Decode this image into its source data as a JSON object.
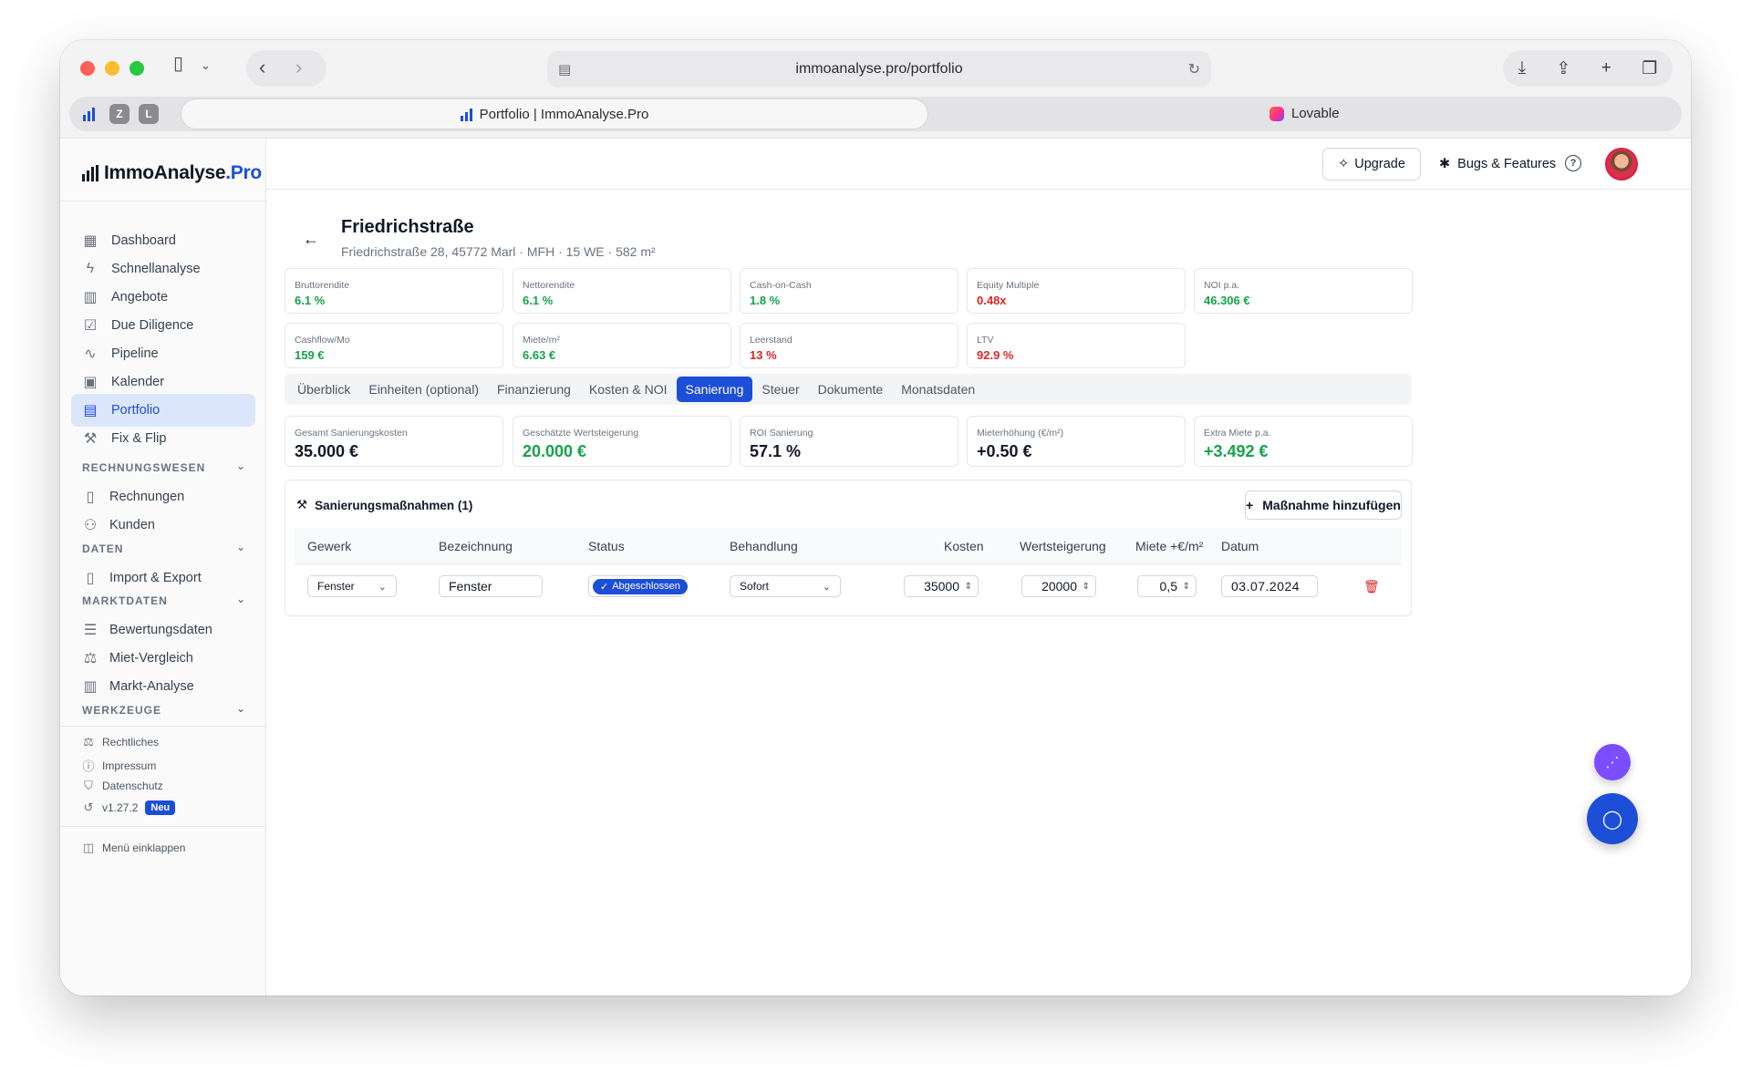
{
  "browser": {
    "url": "immoanalyse.pro/portfolio",
    "mini_tabs": [
      "Z",
      "L"
    ],
    "active_tab_title": "Portfolio | ImmoAnalyse.Pro",
    "inactive_tab_title": "Lovable"
  },
  "sidebar": {
    "logo_main": "ImmoAnalyse",
    "logo_suffix": ".Pro",
    "nav": [
      {
        "label": "Dashboard",
        "icon": "grid-icon"
      },
      {
        "label": "Schnellanalyse",
        "icon": "bolt-icon"
      },
      {
        "label": "Angebote",
        "icon": "building-icon"
      },
      {
        "label": "Due Diligence",
        "icon": "clipboard-check-icon"
      },
      {
        "label": "Pipeline",
        "icon": "activity-icon"
      },
      {
        "label": "Kalender",
        "icon": "calendar-icon"
      },
      {
        "label": "Portfolio",
        "icon": "briefcase-icon"
      },
      {
        "label": "Fix & Flip",
        "icon": "hammer-icon"
      }
    ],
    "sections": {
      "rechnungswesen": {
        "title": "RECHNUNGSWESEN",
        "items": [
          "Rechnungen",
          "Kunden"
        ]
      },
      "daten": {
        "title": "DATEN",
        "items": [
          "Import & Export"
        ]
      },
      "marktdaten": {
        "title": "MARKTDATEN",
        "items": [
          "Bewertungsdaten",
          "Miet-Vergleich",
          "Markt-Analyse"
        ]
      },
      "werkzeuge": {
        "title": "WERKZEUGE"
      }
    },
    "footer_links": [
      "Rechtliches",
      "Impressum",
      "Datenschutz"
    ],
    "version": "v1.27.2",
    "version_badge": "Neu",
    "collapse_label": "Menü einklappen"
  },
  "topbar": {
    "upgrade_label": "Upgrade",
    "bugs_label": "Bugs & Features",
    "help_symbol": "?"
  },
  "property": {
    "title": "Friedrichstraße",
    "subtitle": "Friedrichstraße 28, 45772 Marl · MFH · 15 WE · 582 m²"
  },
  "kpis": [
    {
      "label": "Bruttorendite",
      "value": "6.1 %",
      "color": "#16a34a"
    },
    {
      "label": "Nettorendite",
      "value": "6.1 %",
      "color": "#16a34a"
    },
    {
      "label": "Cash-on-Cash",
      "value": "1.8 %",
      "color": "#16a34a"
    },
    {
      "label": "Equity Multiple",
      "value": "0.48x",
      "color": "#dc2626"
    },
    {
      "label": "NOI p.a.",
      "value": "46.306 €",
      "color": "#16a34a"
    },
    {
      "label": "Cashflow/Mo",
      "value": "159 €",
      "color": "#16a34a"
    },
    {
      "label": "Miete/m²",
      "value": "6.63 €",
      "color": "#16a34a"
    },
    {
      "label": "Leerstand",
      "value": "13 %",
      "color": "#dc2626"
    },
    {
      "label": "LTV",
      "value": "92.9 %",
      "color": "#dc2626"
    }
  ],
  "tabs": [
    "Überblick",
    "Einheiten (optional)",
    "Finanzierung",
    "Kosten & NOI",
    "Sanierung",
    "Steuer",
    "Dokumente",
    "Monatsdaten"
  ],
  "active_tab": "Sanierung",
  "stats": [
    {
      "label": "Gesamt Sanierungskosten",
      "value": "35.000 €"
    },
    {
      "label": "Geschätzte Wertsteigerung",
      "value": "20.000 €"
    },
    {
      "label": "ROI Sanierung",
      "value": "57.1 %"
    },
    {
      "label": "Mieterhöhung (€/m²)",
      "value": "+0.50 €"
    },
    {
      "label": "Extra Miete p.a.",
      "value": "+3.492 €"
    }
  ],
  "measures": {
    "title": "Sanierungsmaßnahmen (1)",
    "add_button": "Maßnahme hinzufügen",
    "columns": [
      "Gewerk",
      "Bezeichnung",
      "Status",
      "Behandlung",
      "Kosten",
      "Wertsteigerung",
      "Miete +€/m²",
      "Datum"
    ],
    "rows": [
      {
        "gewerk": "Fenster",
        "bezeichnung": "Fenster",
        "status": "Abgeschlossen",
        "behandlung": "Sofort",
        "kosten": "35000",
        "wertsteigerung": "20000",
        "miete": "0,5",
        "datum": "03.07.2024"
      }
    ]
  },
  "colors": {
    "accent": "#1d4ed8",
    "positive": "#16a34a",
    "negative": "#dc2626",
    "share_fab": "#7c4dff"
  }
}
